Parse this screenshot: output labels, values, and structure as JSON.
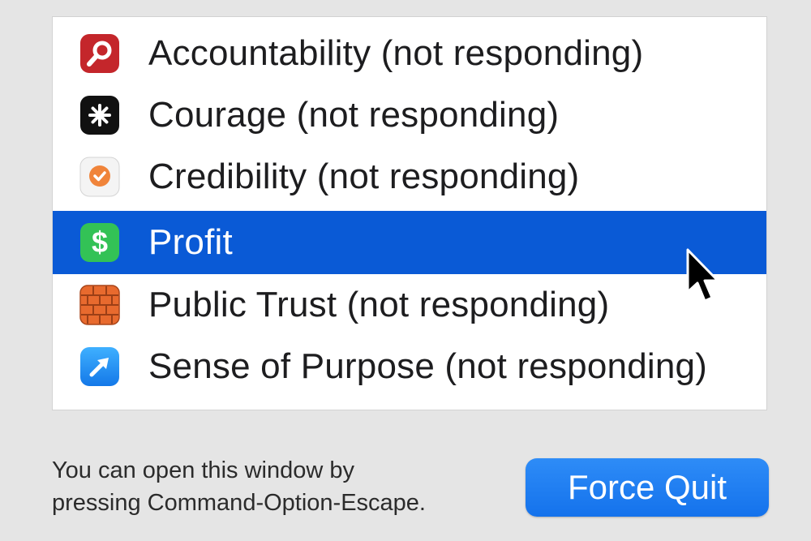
{
  "apps": [
    {
      "name": "Accountability (not responding)",
      "icon": "magnifier-icon",
      "icon_color": "#c4262b",
      "selected": false
    },
    {
      "name": "Courage (not responding)",
      "icon": "asterisk-icon",
      "icon_color": "#111111",
      "selected": false
    },
    {
      "name": "Credibility (not responding)",
      "icon": "checkmark-badge-icon",
      "icon_color": "#f0843a",
      "selected": false
    },
    {
      "name": "Profit",
      "icon": "dollar-icon",
      "icon_color": "#33c256",
      "selected": true
    },
    {
      "name": "Public Trust (not responding)",
      "icon": "brick-wall-icon",
      "icon_color": "#e86a2e",
      "selected": false
    },
    {
      "name": "Sense of Purpose (not responding)",
      "icon": "arrow-icon",
      "icon_color": "#1e8cf0",
      "selected": false
    }
  ],
  "footer": {
    "line1": "You can open this window by",
    "line2": "pressing Command-Option-Escape."
  },
  "force_quit_label": "Force Quit",
  "colors": {
    "selection": "#0a5ad6",
    "button": "#1c7ef1",
    "background": "#e5e5e5"
  }
}
